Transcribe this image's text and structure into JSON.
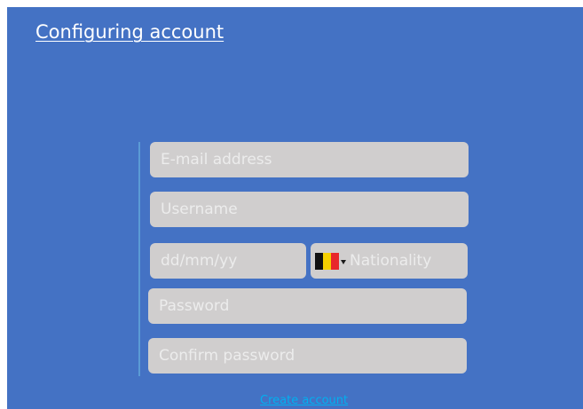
{
  "header": {
    "title": "Configuring account"
  },
  "form": {
    "email": {
      "placeholder": "E-mail address",
      "value": ""
    },
    "username": {
      "placeholder": "Username",
      "value": ""
    },
    "date_of_birth": {
      "placeholder": "dd/mm/yy",
      "value": ""
    },
    "nationality": {
      "placeholder": "Nationality",
      "flag": {
        "icon": "belgium-flag-icon",
        "colors": [
          "#111111",
          "#f5d000",
          "#e8282b"
        ]
      },
      "dropdown_icon": "caret-down-icon"
    },
    "password": {
      "placeholder": "Password",
      "value": ""
    },
    "confirm_password": {
      "placeholder": "Confirm password",
      "value": ""
    }
  },
  "actions": {
    "create_account": "Create account"
  },
  "colors": {
    "background": "#4472c4",
    "field": "#d0cece",
    "placeholder_text": "#ececec",
    "divider": "#5b9bd5",
    "link": "#00b0f0",
    "title": "#ffffff"
  }
}
